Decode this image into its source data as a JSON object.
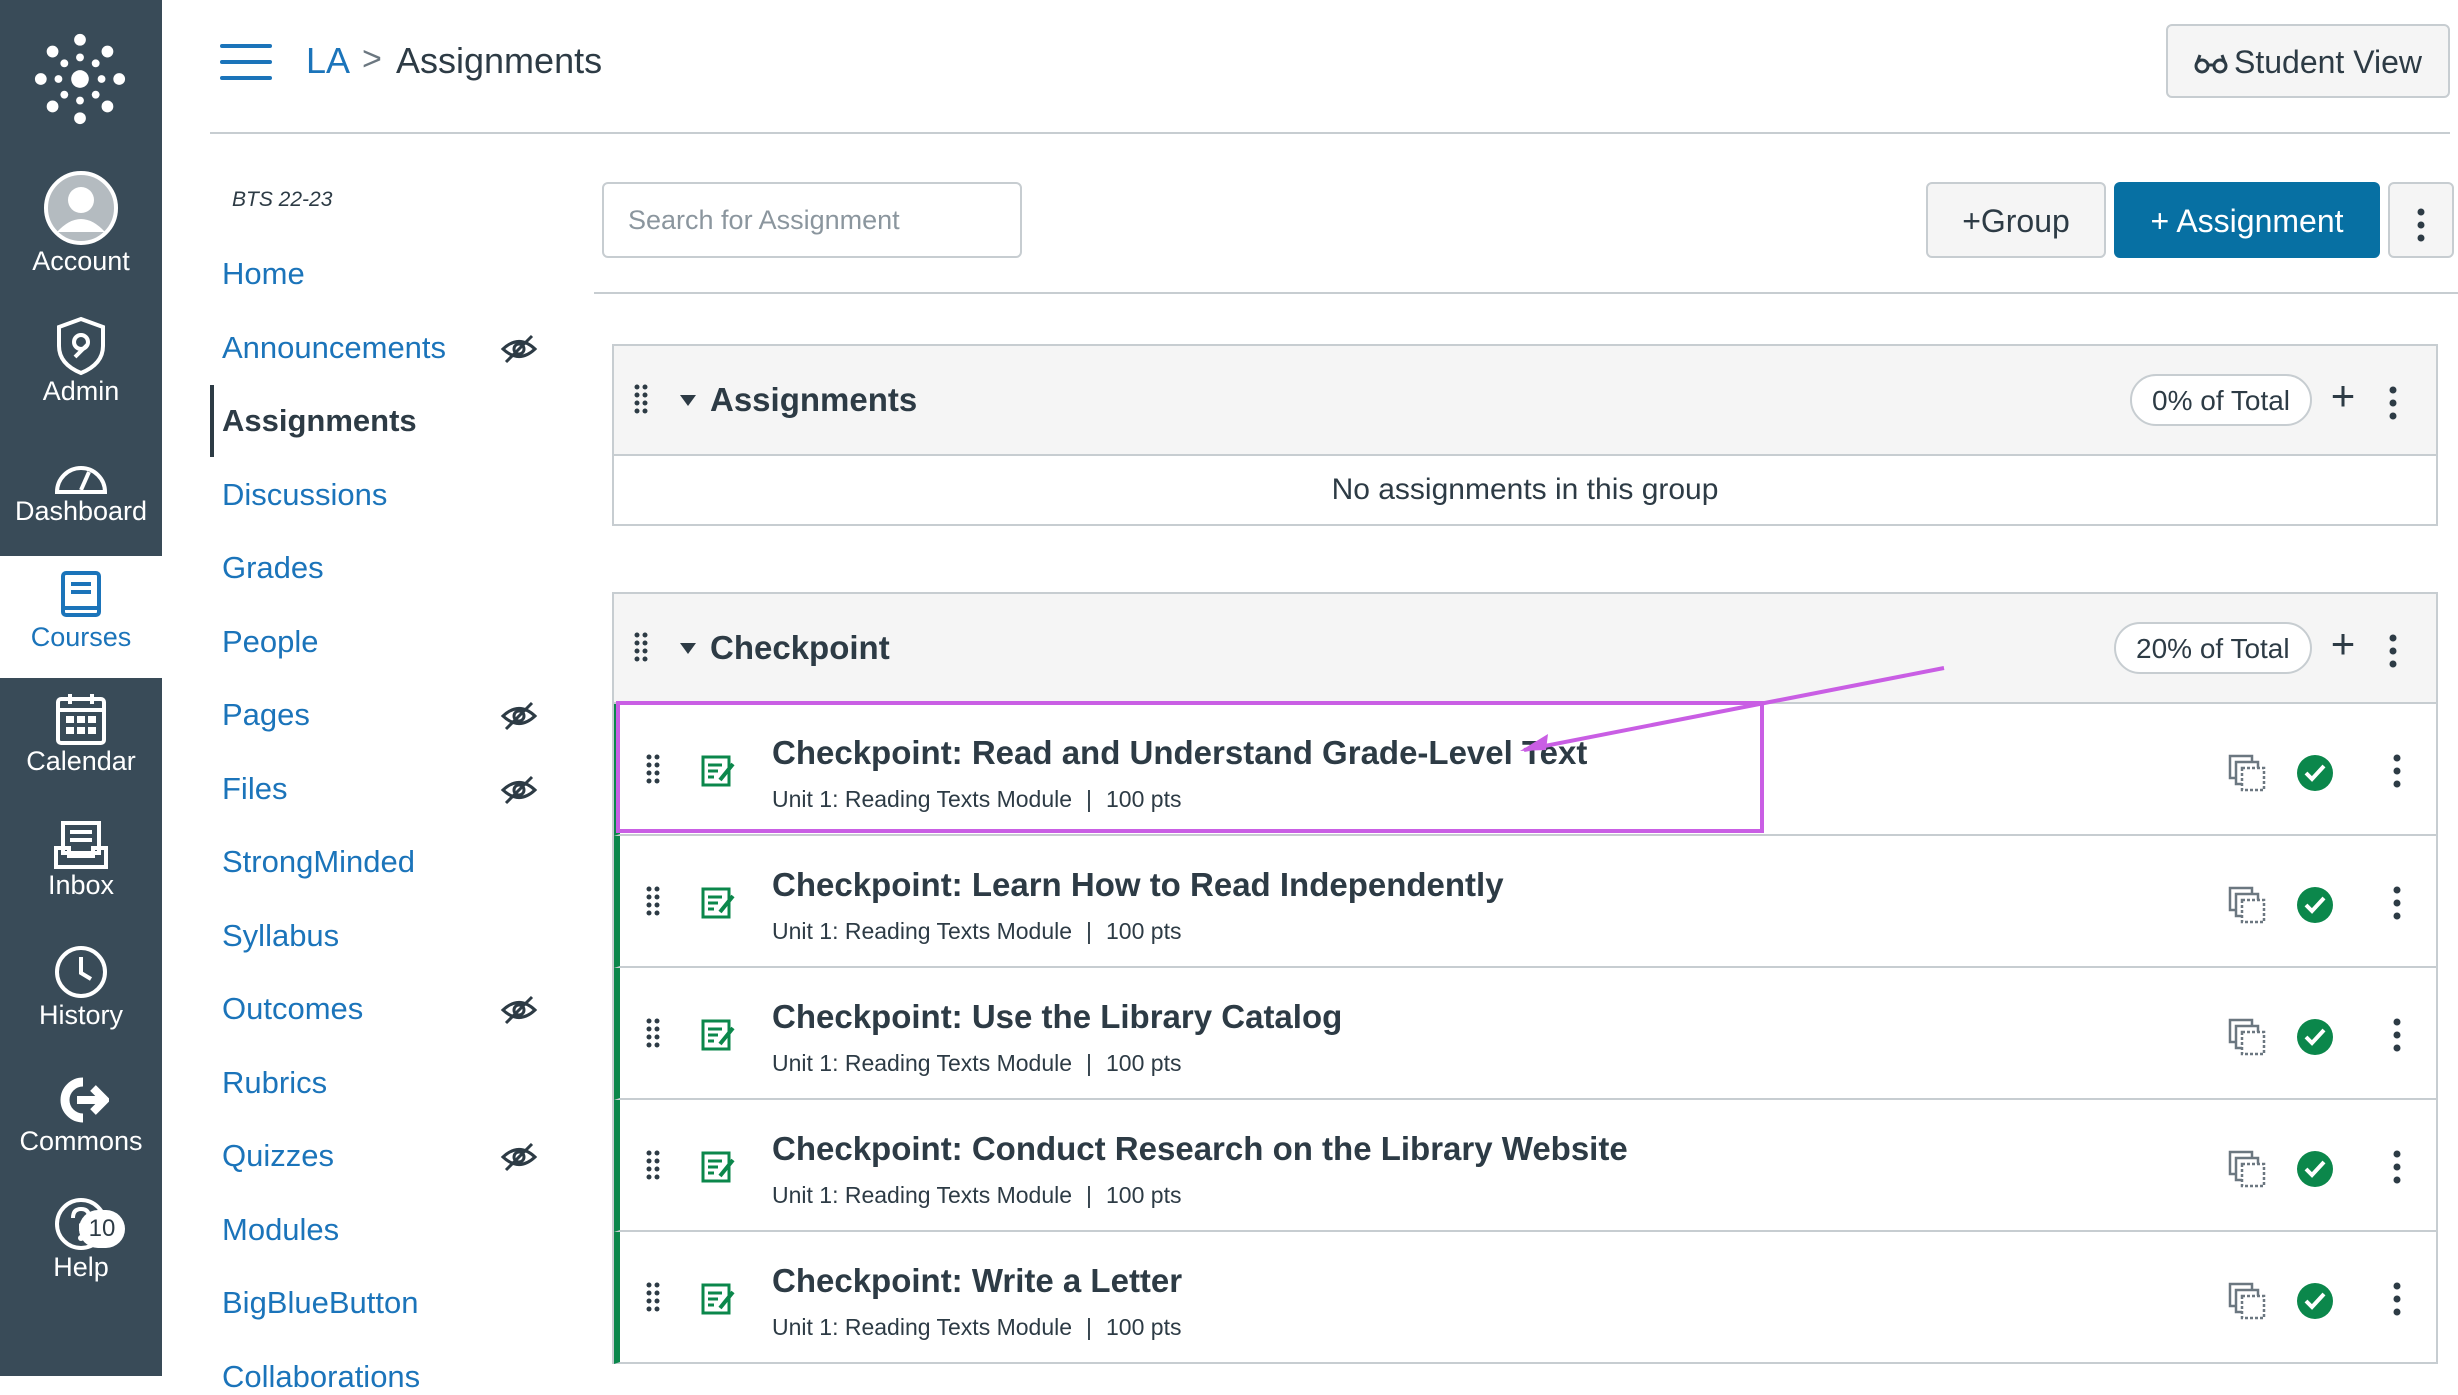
{
  "global_nav": {
    "items": [
      {
        "label": "Account",
        "icon": "avatar"
      },
      {
        "label": "Admin",
        "icon": "admin-shield-icon"
      },
      {
        "label": "Dashboard",
        "icon": "dashboard-icon"
      },
      {
        "label": "Courses",
        "icon": "courses-icon"
      },
      {
        "label": "Calendar",
        "icon": "calendar-icon"
      },
      {
        "label": "Inbox",
        "icon": "inbox-icon"
      },
      {
        "label": "History",
        "icon": "history-icon"
      },
      {
        "label": "Commons",
        "icon": "commons-icon"
      },
      {
        "label": "Help",
        "icon": "help-icon",
        "badge": "10"
      }
    ],
    "active": "Courses",
    "bg_color": "#394b58"
  },
  "header": {
    "breadcrumb_course": "LA",
    "breadcrumb_separator": ">",
    "breadcrumb_page": "Assignments",
    "student_view_label": "Student View"
  },
  "course_nav": {
    "term": "BTS 22-23",
    "items": [
      {
        "label": "Home",
        "hidden": false
      },
      {
        "label": "Announcements",
        "hidden": true
      },
      {
        "label": "Assignments",
        "hidden": false,
        "active": true
      },
      {
        "label": "Discussions",
        "hidden": false
      },
      {
        "label": "Grades",
        "hidden": false
      },
      {
        "label": "People",
        "hidden": false
      },
      {
        "label": "Pages",
        "hidden": true
      },
      {
        "label": "Files",
        "hidden": true
      },
      {
        "label": "StrongMinded",
        "hidden": false
      },
      {
        "label": "Syllabus",
        "hidden": false
      },
      {
        "label": "Outcomes",
        "hidden": true
      },
      {
        "label": "Rubrics",
        "hidden": false
      },
      {
        "label": "Quizzes",
        "hidden": true
      },
      {
        "label": "Modules",
        "hidden": false
      },
      {
        "label": "BigBlueButton",
        "hidden": false
      },
      {
        "label": "Collaborations",
        "hidden": false
      }
    ]
  },
  "toolbar": {
    "search_placeholder": "Search for Assignment",
    "group_button": "+Group",
    "assignment_button": "+ Assignment"
  },
  "groups": [
    {
      "title": "Assignments",
      "weight": "0% of Total",
      "empty_message": "No assignments in this group",
      "assignments": []
    },
    {
      "title": "Checkpoint",
      "weight": "20% of Total",
      "assignments": [
        {
          "title": "Checkpoint: Read and Understand Grade-Level Text",
          "module": "Unit 1: Reading Texts Module",
          "points": "100 pts",
          "published": true
        },
        {
          "title": "Checkpoint: Learn How to Read Independently",
          "module": "Unit 1: Reading Texts Module",
          "points": "100 pts",
          "published": true
        },
        {
          "title": "Checkpoint: Use the Library Catalog",
          "module": "Unit 1: Reading Texts Module",
          "points": "100 pts",
          "published": true
        },
        {
          "title": "Checkpoint: Conduct Research on the Library Website",
          "module": "Unit 1: Reading Texts Module",
          "points": "100 pts",
          "published": true
        },
        {
          "title": "Checkpoint: Write a Letter",
          "module": "Unit 1: Reading Texts Module",
          "points": "100 pts",
          "published": true
        }
      ]
    }
  ],
  "colors": {
    "link": "#1b74ba",
    "primary_button": "#0770a3",
    "published": "#0b874b",
    "annotation": "#c95ee4"
  }
}
